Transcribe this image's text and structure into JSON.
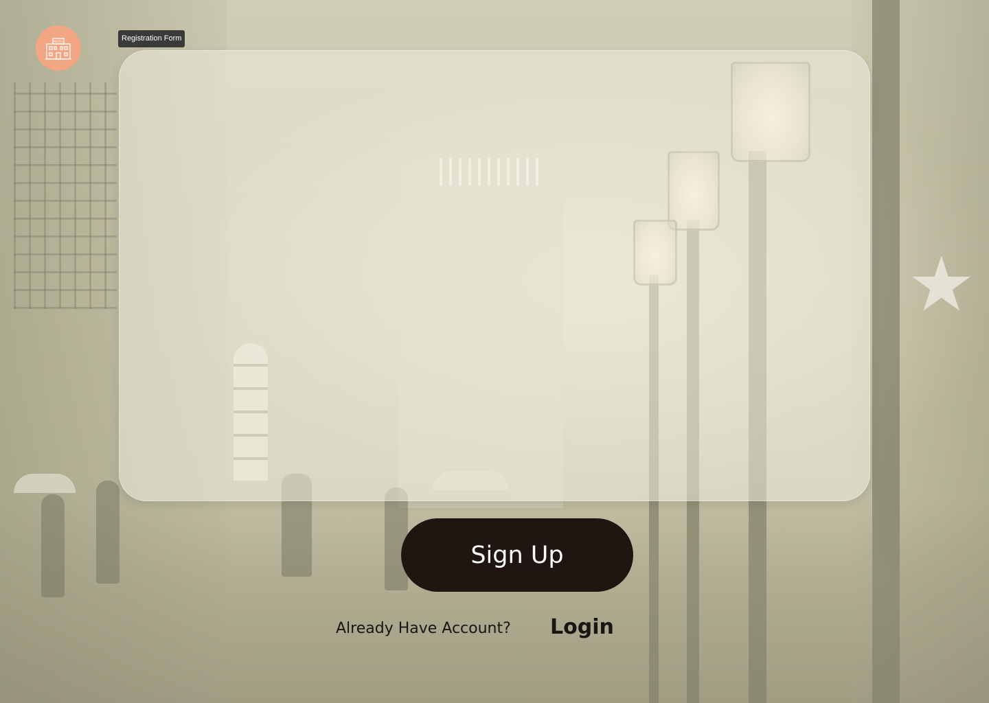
{
  "app": {
    "logo_icon": "hotel-building-icon",
    "logo_text": "HOTEL"
  },
  "frame": {
    "label": "Registration Form"
  },
  "actions": {
    "signup_label": "Sign Up",
    "already_account_text": "Already Have Account?",
    "login_label": "Login"
  },
  "colors": {
    "logo_bg": "#f2a684",
    "button_bg": "#1f1611",
    "button_text": "#ffffff",
    "text_dark": "#1a1512",
    "frame_label_bg": "#3a3a3a"
  }
}
